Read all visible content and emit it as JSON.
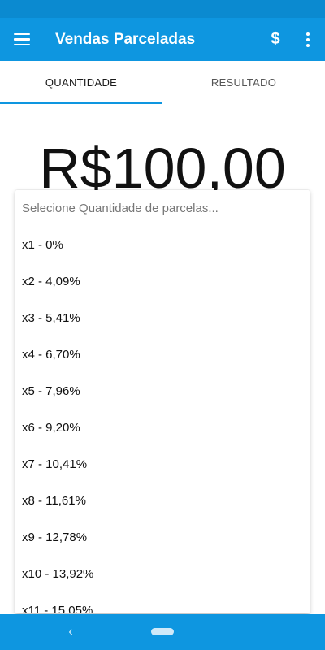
{
  "app_bar": {
    "title": "Vendas Parceladas",
    "currency_symbol": "$",
    "menu_icon": "hamburger-menu-icon",
    "more_icon": "more-vert-icon"
  },
  "tabs": [
    {
      "label": "QUANTIDADE",
      "selected": true
    },
    {
      "label": "RESULTADO",
      "selected": false
    }
  ],
  "amount": "R$100,00",
  "dropdown": {
    "placeholder": "Selecione Quantidade de parcelas...",
    "options": [
      "x1 - 0%",
      "x2 - 4,09%",
      "x3 - 5,41%",
      "x4 - 6,70%",
      "x5 - 7,96%",
      "x6 - 9,20%",
      "x7 - 10,41%",
      "x8 - 11,61%",
      "x9 - 12,78%",
      "x10 - 13,92%",
      "x11 - 15,05%"
    ]
  },
  "nav": {
    "back_icon": "‹"
  },
  "colors": {
    "primary": "#0e96e0",
    "status_bar": "#0b8ad0"
  }
}
